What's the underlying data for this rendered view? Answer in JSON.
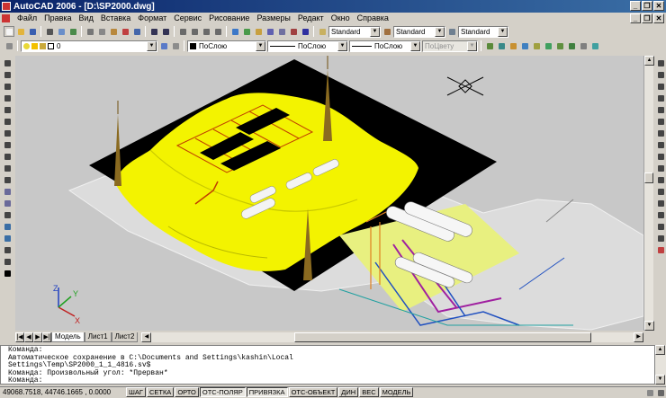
{
  "window": {
    "title": "AutoCAD 2006 - [D:\\SP2000.dwg]",
    "minimize": "_",
    "restore": "❐",
    "close": "✕"
  },
  "menu": [
    "Файл",
    "Правка",
    "Вид",
    "Вставка",
    "Формат",
    "Сервис",
    "Рисование",
    "Размеры",
    "Редакт",
    "Окно",
    "Справка"
  ],
  "styles": {
    "text_style": "Standard",
    "dim_style": "Standard",
    "table_style": "Standard"
  },
  "layer": {
    "current": "0"
  },
  "properties": {
    "color": "ПоСлою",
    "linetype": "ПоСлою",
    "lineweight": "ПоСлою",
    "plotstyle": "ПоЦвету"
  },
  "tabs": [
    "Модель",
    "Лист1",
    "Лист2"
  ],
  "command_lines": [
    "Команда:",
    "Автоматическое сохранение в C:\\Documents and Settings\\kashin\\Local",
    "Settings\\Temp\\SP2000_1_1_4816.sv$",
    "Команда: Произвольный угол: *Прерван*",
    "Команда:"
  ],
  "status": {
    "coords": "49068.7518, 44746.1665 , 0.0000",
    "toggles": [
      "ШАГ",
      "СЕТКА",
      "ОРТО",
      "ОТС-ПОЛЯР",
      "ПРИВЯЗКА",
      "ОТС-ОБЪЕКТ",
      "ДИН",
      "ВЕС",
      "МОДЕЛЬ"
    ],
    "toggles_on": [
      "ОТС-ПОЛЯР",
      "ПРИВЯЗКА"
    ]
  },
  "ucs_labels": {
    "x": "X",
    "y": "Y",
    "z": "Z"
  },
  "colors": {
    "terrain": "#f3f300",
    "site_black": "#000000",
    "background": "#c8c8c8"
  }
}
